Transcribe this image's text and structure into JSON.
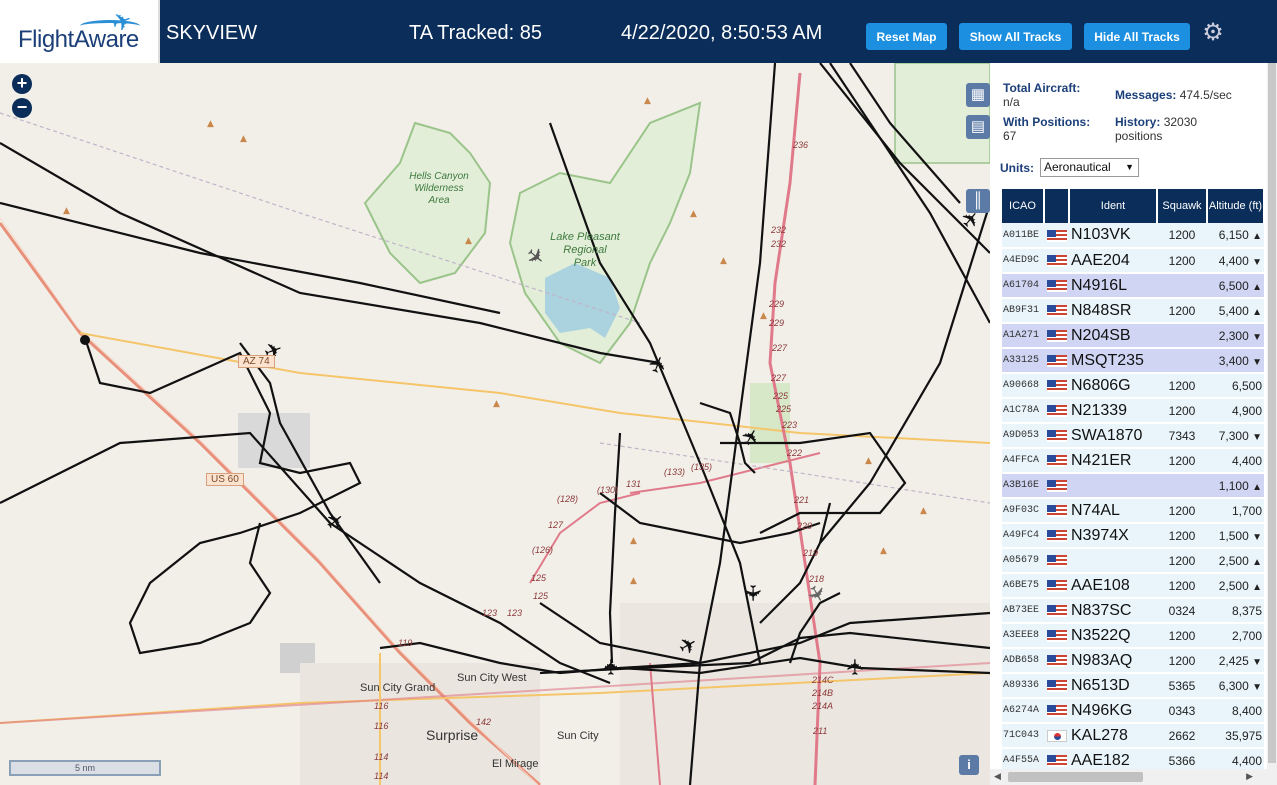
{
  "header": {
    "logo_text": "FlightAware",
    "app_name": "SKYVIEW",
    "tracked_label": "TA Tracked: 85",
    "datetime": "4/22/2020, 8:50:53 AM",
    "reset_map": "Reset Map",
    "show_all_tracks": "Show All Tracks",
    "hide_all_tracks": "Hide All Tracks",
    "settings_icon": "gear-icon"
  },
  "map": {
    "zoom_in": "+",
    "zoom_out": "−",
    "scale_label": "5 nm",
    "info_label": "i",
    "labels": {
      "hells_canyon": [
        "Hells Canyon",
        "Wilderness",
        "Area"
      ],
      "lake_pleasant": [
        "Lake Pleasant",
        "Regional",
        "Park"
      ],
      "az74": "AZ 74",
      "us60": "US 60",
      "sun_city_grand": "Sun City Grand",
      "sun_city_west": "Sun City West",
      "surprise": "Surprise",
      "sun_city": "Sun City",
      "el_mirage": "El Mirage"
    },
    "road_numbers": [
      "236",
      "232",
      "232",
      "229",
      "229",
      "227",
      "227",
      "225",
      "225",
      "223",
      "222",
      "221",
      "220",
      "219",
      "218",
      "131",
      "(128)",
      "(130)",
      "(133)",
      "(135)",
      "(126)",
      "127",
      "125",
      "125",
      "123",
      "123",
      "119",
      "116",
      "116",
      "114",
      "114",
      "142",
      "214C",
      "214B",
      "214A",
      "211"
    ]
  },
  "stats": {
    "total_aircraft_label": "Total Aircraft:",
    "total_aircraft_value": "n/a",
    "with_positions_label": "With Positions:",
    "with_positions_value": "67",
    "messages_label": "Messages:",
    "messages_value": "474.5/sec",
    "history_label": "History:",
    "history_value": "32030",
    "history_unit": "positions"
  },
  "units": {
    "label": "Units:",
    "selected": "Aeronautical"
  },
  "table": {
    "columns": [
      "ICAO",
      "",
      "Ident",
      "Squawk",
      "Altitude (ft)"
    ],
    "rows": [
      {
        "icao": "A011BE",
        "flag": "us",
        "ident": "N103VK",
        "squawk": "1200",
        "alt": "6,150",
        "trend": "▲",
        "sel": false
      },
      {
        "icao": "A4ED9C",
        "flag": "us",
        "ident": "AAE204",
        "squawk": "1200",
        "alt": "4,400",
        "trend": "▼",
        "sel": false
      },
      {
        "icao": "A61704",
        "flag": "us",
        "ident": "N4916L",
        "squawk": "",
        "alt": "6,500",
        "trend": "▲",
        "sel": true
      },
      {
        "icao": "AB9F31",
        "flag": "us",
        "ident": "N848SR",
        "squawk": "1200",
        "alt": "5,400",
        "trend": "▲",
        "sel": false
      },
      {
        "icao": "A1A271",
        "flag": "us",
        "ident": "N204SB",
        "squawk": "",
        "alt": "2,300",
        "trend": "▼",
        "sel": true
      },
      {
        "icao": "A33125",
        "flag": "us",
        "ident": "MSQT235",
        "squawk": "",
        "alt": "3,400",
        "trend": "▼",
        "sel": true
      },
      {
        "icao": "A90668",
        "flag": "us",
        "ident": "N6806G",
        "squawk": "1200",
        "alt": "6,500",
        "trend": "",
        "sel": false
      },
      {
        "icao": "A1C78A",
        "flag": "us",
        "ident": "N21339",
        "squawk": "1200",
        "alt": "4,900",
        "trend": "",
        "sel": false
      },
      {
        "icao": "A9D053",
        "flag": "us",
        "ident": "SWA1870",
        "squawk": "7343",
        "alt": "7,300",
        "trend": "▼",
        "sel": false
      },
      {
        "icao": "A4FFCA",
        "flag": "us",
        "ident": "N421ER",
        "squawk": "1200",
        "alt": "4,400",
        "trend": "",
        "sel": false
      },
      {
        "icao": "A3B16E",
        "flag": "us",
        "ident": "",
        "squawk": "",
        "alt": "1,100",
        "trend": "▲",
        "sel": true
      },
      {
        "icao": "A9F03C",
        "flag": "us",
        "ident": "N74AL",
        "squawk": "1200",
        "alt": "1,700",
        "trend": "",
        "sel": false
      },
      {
        "icao": "A49FC4",
        "flag": "us",
        "ident": "N3974X",
        "squawk": "1200",
        "alt": "1,500",
        "trend": "▼",
        "sel": false
      },
      {
        "icao": "A05679",
        "flag": "us",
        "ident": "",
        "squawk": "1200",
        "alt": "2,500",
        "trend": "▲",
        "sel": false
      },
      {
        "icao": "A6BE75",
        "flag": "us",
        "ident": "AAE108",
        "squawk": "1200",
        "alt": "2,500",
        "trend": "▲",
        "sel": false
      },
      {
        "icao": "AB73EE",
        "flag": "us",
        "ident": "N837SC",
        "squawk": "0324",
        "alt": "8,375",
        "trend": "",
        "sel": false
      },
      {
        "icao": "A3EEE8",
        "flag": "us",
        "ident": "N3522Q",
        "squawk": "1200",
        "alt": "2,700",
        "trend": "",
        "sel": false
      },
      {
        "icao": "ADB658",
        "flag": "us",
        "ident": "N983AQ",
        "squawk": "1200",
        "alt": "2,425",
        "trend": "▼",
        "sel": false
      },
      {
        "icao": "A89336",
        "flag": "us",
        "ident": "N6513D",
        "squawk": "5365",
        "alt": "6,300",
        "trend": "▼",
        "sel": false
      },
      {
        "icao": "A6274A",
        "flag": "us",
        "ident": "N496KG",
        "squawk": "0343",
        "alt": "8,400",
        "trend": "",
        "sel": false
      },
      {
        "icao": "71C043",
        "flag": "kr",
        "ident": "KAL278",
        "squawk": "2662",
        "alt": "35,975",
        "trend": "",
        "sel": false
      },
      {
        "icao": "A4F55A",
        "flag": "us",
        "ident": "AAE182",
        "squawk": "5366",
        "alt": "4,400",
        "trend": "",
        "sel": false
      }
    ]
  }
}
